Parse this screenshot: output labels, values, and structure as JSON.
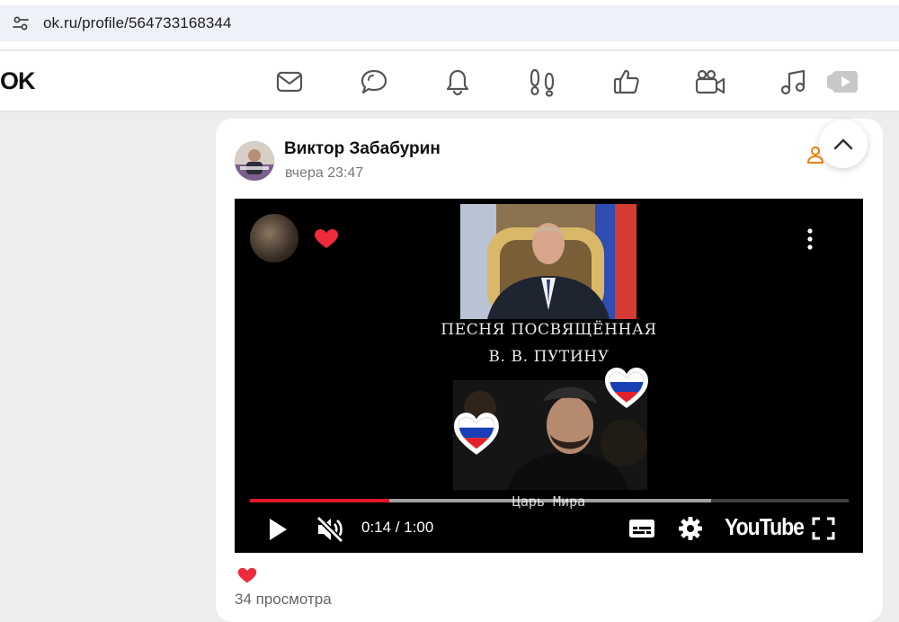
{
  "browser": {
    "url": "ok.ru/profile/564733168344"
  },
  "header": {
    "logo": "OK",
    "nav_icons": [
      "messages-icon",
      "discussions-icon",
      "notifications-icon",
      "guests-icon",
      "marks-icon",
      "video-icon",
      "music-icon",
      "video-showcase-icon"
    ]
  },
  "post": {
    "author": "Виктор Забабурин",
    "time": "вчера 23:47",
    "views": "34 просмотра"
  },
  "video": {
    "caption_line1": "ПЕСНЯ ПОСВЯЩЁННАЯ",
    "caption_line2": "В. В. ПУТИНУ",
    "song_title": "Царь Мира",
    "current_time": "0:14 / 1:00",
    "progress_fraction": 0.233,
    "buffered_fraction": 0.77,
    "brand": "YouTube"
  },
  "colors": {
    "accent_red": "#e1162b",
    "heart_red": "#ee2b3b",
    "ok_orange": "#ee8208"
  }
}
